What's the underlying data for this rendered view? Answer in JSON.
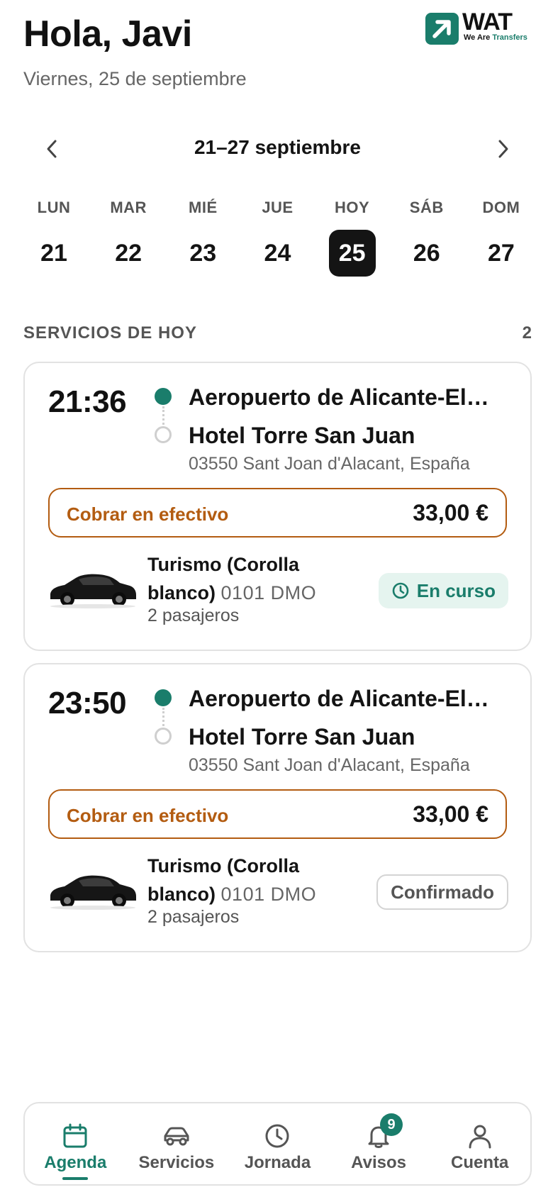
{
  "header": {
    "greeting": "Hola, Javi",
    "date": "Viernes, 25 de septiembre",
    "logo_text": "WAT",
    "logo_sub_a": "We Are ",
    "logo_sub_b": "Transfers"
  },
  "week": {
    "label": "21–27 septiembre",
    "prev_icon": "chevron-left-icon",
    "next_icon": "chevron-right-icon",
    "days": [
      {
        "name": "LUN",
        "num": "21"
      },
      {
        "name": "MAR",
        "num": "22"
      },
      {
        "name": "MIÉ",
        "num": "23"
      },
      {
        "name": "JUE",
        "num": "24"
      },
      {
        "name": "HOY",
        "num": "25"
      },
      {
        "name": "SÁB",
        "num": "26"
      },
      {
        "name": "DOM",
        "num": "27"
      }
    ],
    "selected_index": 4
  },
  "services": {
    "title": "SERVICIOS DE HOY",
    "count": "2",
    "items": [
      {
        "time": "21:36",
        "origin": "Aeropuerto de Alicante-Elche Miguel Hernández",
        "destination": "Hotel Torre San Juan",
        "address": "03550 Sant Joan d'Alacant, España",
        "cash_label": "Cobrar en efectivo",
        "cash_amount": "33,00 €",
        "vehicle": "Turismo (Corolla blanco)",
        "plate": "0101 DMO",
        "passengers": "2 pasajeros",
        "status": "En curso"
      },
      {
        "time": "23:50",
        "origin": "Aeropuerto de Alicante-Elche Miguel Hernández",
        "destination": "Hotel Torre San Juan",
        "address": "03550 Sant Joan d'Alacant, España",
        "cash_label": "Cobrar en efectivo",
        "cash_amount": "33,00 €",
        "vehicle": "Turismo (Corolla blanco)",
        "plate": "0101 DMO",
        "passengers": "2 pasajeros",
        "status": "Confirmado"
      }
    ]
  },
  "tabs": [
    {
      "label": "Agenda",
      "icon": "calendar-icon",
      "active": true
    },
    {
      "label": "Servicios",
      "icon": "car-icon"
    },
    {
      "label": "Jornada",
      "icon": "clock-icon"
    },
    {
      "label": "Avisos",
      "icon": "bell-icon",
      "badge": "9"
    },
    {
      "label": "Cuenta",
      "icon": "user-icon"
    }
  ],
  "colors": {
    "accent": "#1a7d6b",
    "cash": "#b35c11",
    "text": "#141414",
    "muted": "#666666",
    "status_live_bg": "#e5f4ef"
  }
}
